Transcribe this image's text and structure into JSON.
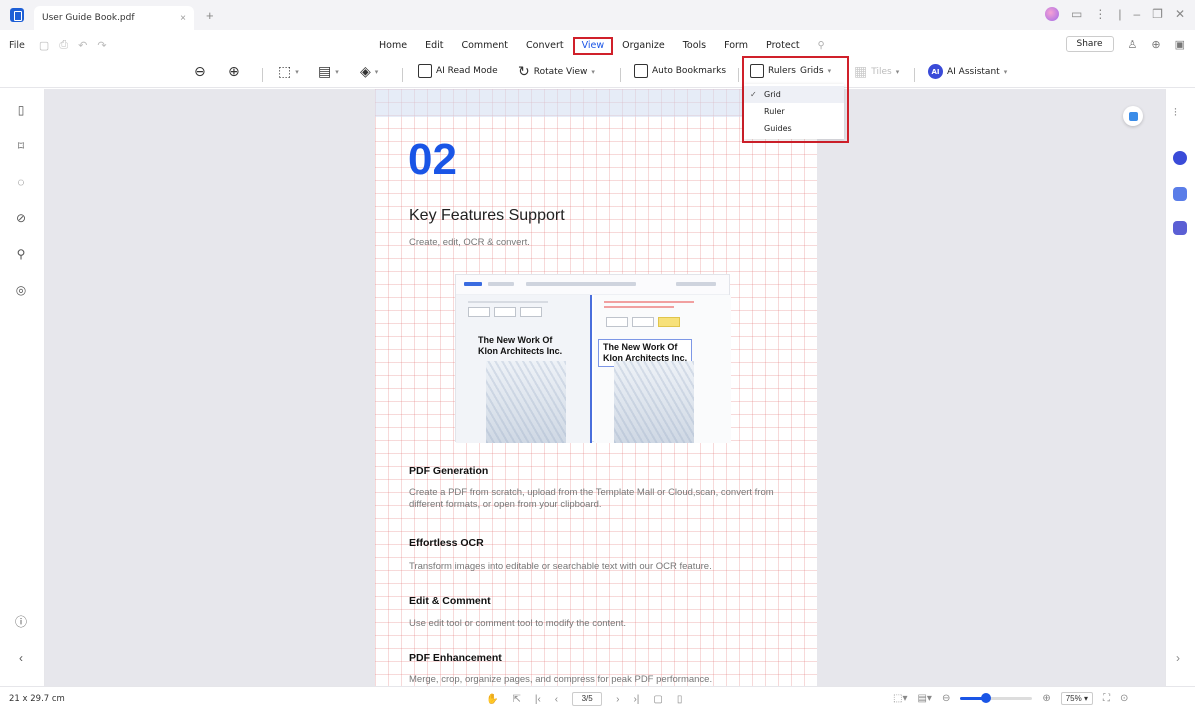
{
  "titlebar": {
    "tab_title": "User Guide Book.pdf",
    "tab_close": "×",
    "new_tab": "+"
  },
  "menubar": {
    "file": "File",
    "items": [
      "Home",
      "Edit",
      "Comment",
      "Convert",
      "View",
      "Organize",
      "Tools",
      "Form",
      "Protect"
    ],
    "active": "View",
    "share": "Share"
  },
  "toolbar": {
    "ai_read_mode": "AI Read Mode",
    "rotate_view": "Rotate View",
    "auto_bookmarks": "Auto Bookmarks",
    "rulers": "Rulers",
    "grids": "Grids",
    "tiles": "Tiles",
    "ai_assistant": "AI Assistant",
    "ai_badge": "AI"
  },
  "grids_dropdown": {
    "options": [
      "Grid",
      "Ruler",
      "Guides"
    ],
    "checked": "Grid",
    "check_mark": "✓"
  },
  "document": {
    "number": "02",
    "heading": "Key Features Support",
    "subheading": "Create, edit, OCR & convert.",
    "illustration_title_left": "The New Work Of\nKlon Architects Inc.",
    "illustration_title_right": "The New Work Of\nKlon Architects Inc.",
    "sections": [
      {
        "title": "PDF Generation",
        "text": "Create a PDF from scratch, upload from the Template Mall or Cloud,scan, convert from different formats, or open from your clipboard."
      },
      {
        "title": "Effortless OCR",
        "text": "Transform images into editable or searchable text with our OCR feature."
      },
      {
        "title": "Edit & Comment",
        "text": "Use edit tool or comment tool to modify the content."
      },
      {
        "title": "PDF Enhancement",
        "text": "Merge, crop, organize pages, and compress for peak PDF performance."
      }
    ]
  },
  "statusbar": {
    "page_size": "21 x 29.7 cm",
    "page_indicator": "3/5",
    "zoom": "75%",
    "zoom_fraction": 0.35
  },
  "colors": {
    "accent": "#1a55e6",
    "highlight_red": "#d0202a",
    "grid_line": "#e27878"
  }
}
